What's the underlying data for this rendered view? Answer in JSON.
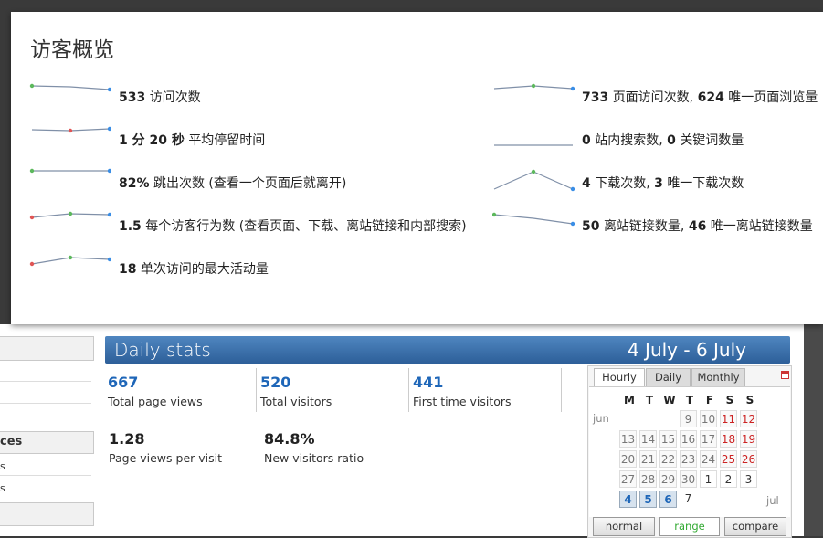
{
  "overview": {
    "title": "访客概览",
    "left_metrics": [
      {
        "value": "533",
        "label": "访问次数",
        "sparkline": "down"
      },
      {
        "value": "1 分 20 秒",
        "label": "平均停留时间",
        "sparkline": "flat"
      },
      {
        "value": "82%",
        "label": "跳出次数 (查看一个页面后就离开)",
        "sparkline": "flat"
      },
      {
        "value": "1.5",
        "label": "每个访客行为数 (查看页面、下载、离站链接和内部搜索)",
        "sparkline": "up-flat"
      },
      {
        "value": "18",
        "label": "单次访问的最大活动量",
        "sparkline": "up-flat"
      }
    ],
    "right_metrics": [
      {
        "value": "733",
        "label": "页面访问次数,",
        "value2": "624",
        "label2": "唯一页面浏览量",
        "sparkline": "peak-slight"
      },
      {
        "value": "0",
        "label": "站内搜索数,",
        "value2": "0",
        "label2": "关键词数量",
        "sparkline": "flat"
      },
      {
        "value": "4",
        "label": "下载次数,",
        "value2": "3",
        "label2": "唯一下载次数",
        "sparkline": "peak"
      },
      {
        "value": "50",
        "label": "离站链接数量,",
        "value2": "46",
        "label2": "唯一离站链接数量",
        "sparkline": "down"
      }
    ]
  },
  "left_nav": {
    "partial_heading_1": "ces",
    "partial_item_1": "s",
    "partial_item_2": "s"
  },
  "daily_stats": {
    "title": "Daily stats",
    "range": "4 July - 6 July",
    "stats": [
      {
        "value": "667",
        "label": "Total page views"
      },
      {
        "value": "520",
        "label": "Total visitors"
      },
      {
        "value": "441",
        "label": "First time visitors"
      },
      {
        "value": "1.28",
        "label": "Page views per visit"
      },
      {
        "value": "84.8%",
        "label": "New visitors ratio"
      }
    ]
  },
  "calendar": {
    "tabs": [
      "Hourly",
      "Daily",
      "Monthly"
    ],
    "active_tab": "Hourly",
    "weekdays": [
      "M",
      "T",
      "W",
      "T",
      "F",
      "S",
      "S"
    ],
    "month_start": "jun",
    "month_end": "jul",
    "rows": [
      [
        "",
        "",
        "",
        "9",
        "10",
        "11",
        "12"
      ],
      [
        "13",
        "14",
        "15",
        "16",
        "17",
        "18",
        "19"
      ],
      [
        "20",
        "21",
        "22",
        "23",
        "24",
        "25",
        "26"
      ],
      [
        "27",
        "28",
        "29",
        "30",
        "1",
        "2",
        "3"
      ],
      [
        "4",
        "5",
        "6",
        "7",
        "",
        "",
        ""
      ]
    ],
    "buttons": [
      "normal",
      "range",
      "compare"
    ],
    "active_button": "range",
    "colors": {
      "weekend": "#cc2222",
      "selected": "#1e66b8",
      "header": "#2d5f99"
    }
  }
}
